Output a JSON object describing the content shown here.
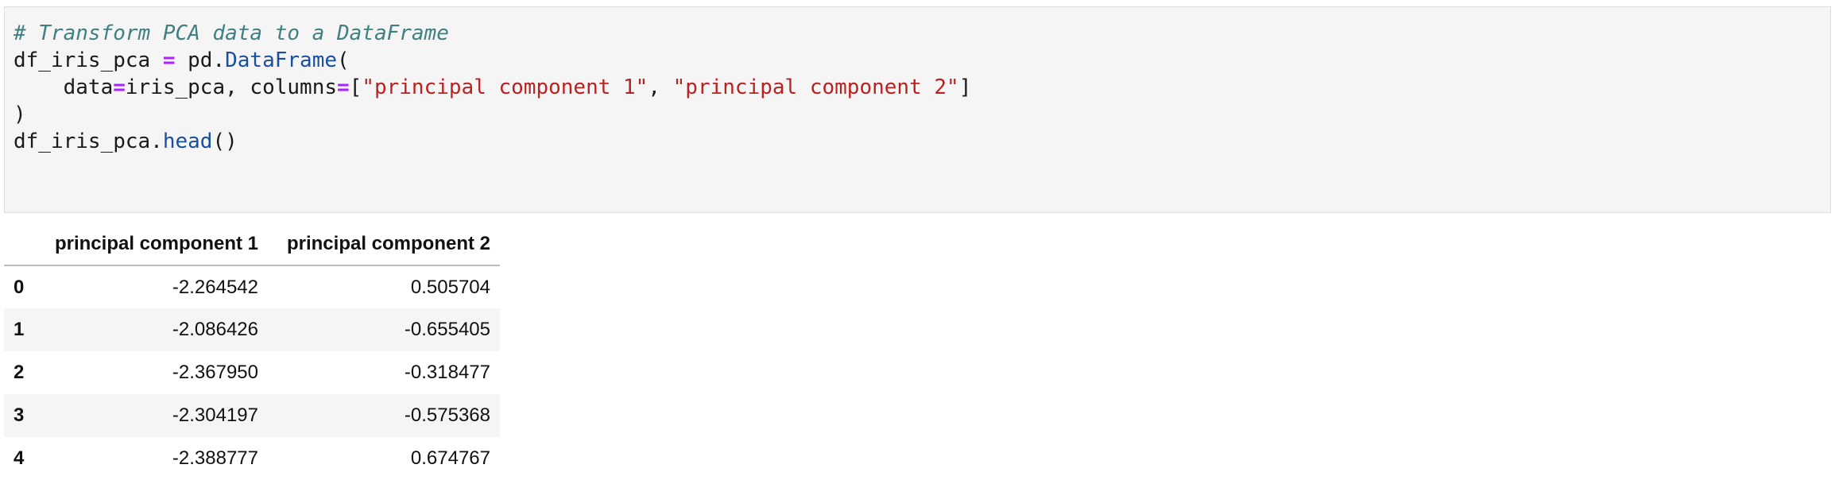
{
  "code_cell": {
    "lines": [
      [
        {
          "t": "# Transform PCA data to a DataFrame",
          "c": "cm"
        }
      ],
      [
        {
          "t": "df_iris_pca ",
          "c": ""
        },
        {
          "t": "=",
          "c": "op"
        },
        {
          "t": " pd.",
          "c": ""
        },
        {
          "t": "DataFrame",
          "c": "fn"
        },
        {
          "t": "(",
          "c": ""
        }
      ],
      [
        {
          "t": "    data",
          "c": ""
        },
        {
          "t": "=",
          "c": "op"
        },
        {
          "t": "iris_pca, columns",
          "c": ""
        },
        {
          "t": "=",
          "c": "op"
        },
        {
          "t": "[",
          "c": ""
        },
        {
          "t": "\"principal component 1\"",
          "c": "st"
        },
        {
          "t": ", ",
          "c": ""
        },
        {
          "t": "\"principal component 2\"",
          "c": "st"
        },
        {
          "t": "]",
          "c": ""
        }
      ],
      [
        {
          "t": ")",
          "c": ""
        }
      ],
      [
        {
          "t": "df_iris_pca.",
          "c": ""
        },
        {
          "t": "head",
          "c": "fn"
        },
        {
          "t": "()",
          "c": ""
        }
      ]
    ]
  },
  "output_table": {
    "columns": [
      "",
      "principal component 1",
      "principal component 2"
    ],
    "rows": [
      {
        "index": "0",
        "pc1": "-2.264542",
        "pc2": "0.505704"
      },
      {
        "index": "1",
        "pc1": "-2.086426",
        "pc2": "-0.655405"
      },
      {
        "index": "2",
        "pc1": "-2.367950",
        "pc2": "-0.318477"
      },
      {
        "index": "3",
        "pc1": "-2.304197",
        "pc2": "-0.575368"
      },
      {
        "index": "4",
        "pc1": "-2.388777",
        "pc2": "0.674767"
      }
    ]
  }
}
